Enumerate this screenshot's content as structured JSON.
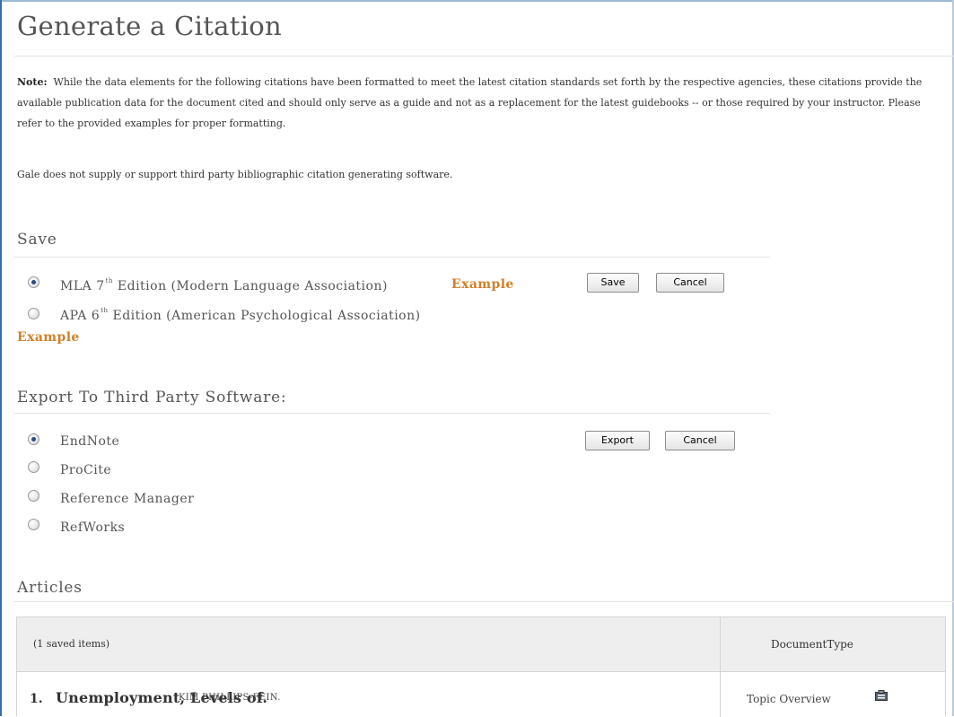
{
  "page": {
    "title": "Generate a Citation",
    "note_label": "Note:",
    "note_text": "While the data elements for the following citations have been formatted to meet the latest citation standards set forth by the respective agencies, these citations provide the available publication data for the document cited and should only serve as a guide and not as a replacement for the latest guidebooks -- or those required by your instructor. Please refer to the provided examples for proper formatting.",
    "gale_notice": "Gale does not supply or support third party bibliographic citation generating software."
  },
  "save_section": {
    "heading": "Save",
    "options": [
      {
        "label_main": "MLA 7",
        "label_sup": "th",
        "label_rest": " Edition (Modern Language Association)",
        "selected": true,
        "example": "Example"
      },
      {
        "label_main": "APA 6",
        "label_sup": "th",
        "label_rest": " Edition (American Psychological Association)",
        "selected": false,
        "example": "Example"
      }
    ],
    "save_button": "Save",
    "cancel_button": "Cancel"
  },
  "export_section": {
    "heading": "Export To Third Party Software:",
    "options": [
      {
        "label": "EndNote",
        "selected": true
      },
      {
        "label": "ProCite",
        "selected": false
      },
      {
        "label": "Reference Manager",
        "selected": false
      },
      {
        "label": "RefWorks",
        "selected": false
      }
    ],
    "export_button": "Export",
    "cancel_button": "Cancel"
  },
  "articles_section": {
    "heading": "Articles",
    "table": {
      "header_items": "(1 saved items)",
      "header_doctype": "DocumentType",
      "rows": [
        {
          "number": "1.",
          "title": "Unemployment, Levels of.",
          "author": "KIM PHILLIPS-FEIN.",
          "doc_type": "Topic Overview",
          "doc_icon": "document-type-icon"
        }
      ]
    }
  },
  "colors": {
    "accent_link": "#d0802a",
    "frame_border": "#3a6ea5",
    "header_bg": "#eeeeee"
  }
}
